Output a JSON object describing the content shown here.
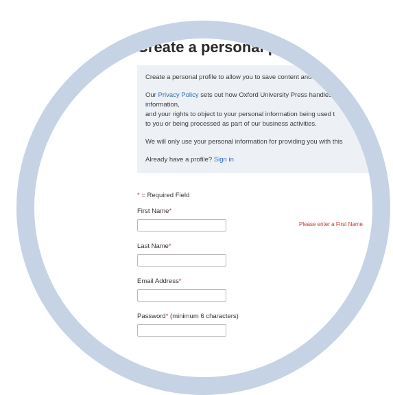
{
  "page": {
    "title": "Create a personal profile"
  },
  "intro": {
    "line1": "Create a personal profile to allow you to save content and",
    "privacy_prefix": "Our ",
    "privacy_link": "Privacy Policy",
    "privacy_suffix": " sets out how Oxford University Press handles",
    "line_information": "information,",
    "line_rights1": "and your rights to object to your personal information being used t",
    "line_rights2": "to you or being processed as part of our business activities.",
    "line_only_use": "We will only use your personal information for providing you with this",
    "already_prefix": "Already have a profile? ",
    "sign_in": "Sign in"
  },
  "form": {
    "required_star": "*",
    "required_note": " = Required Field",
    "first_name_label": "First Name",
    "first_name_value": "",
    "first_name_error": "Please enter a First Name",
    "last_name_label": "Last Name",
    "last_name_value": "",
    "email_label": "Email Address",
    "email_value": "",
    "password_label": "Password",
    "password_hint": " (minimum 6 characters)",
    "password_value": ""
  },
  "colors": {
    "ring": "#c5d3e5",
    "info_bg": "#edf1f6",
    "link": "#2d6db3",
    "required": "#c0392b"
  }
}
